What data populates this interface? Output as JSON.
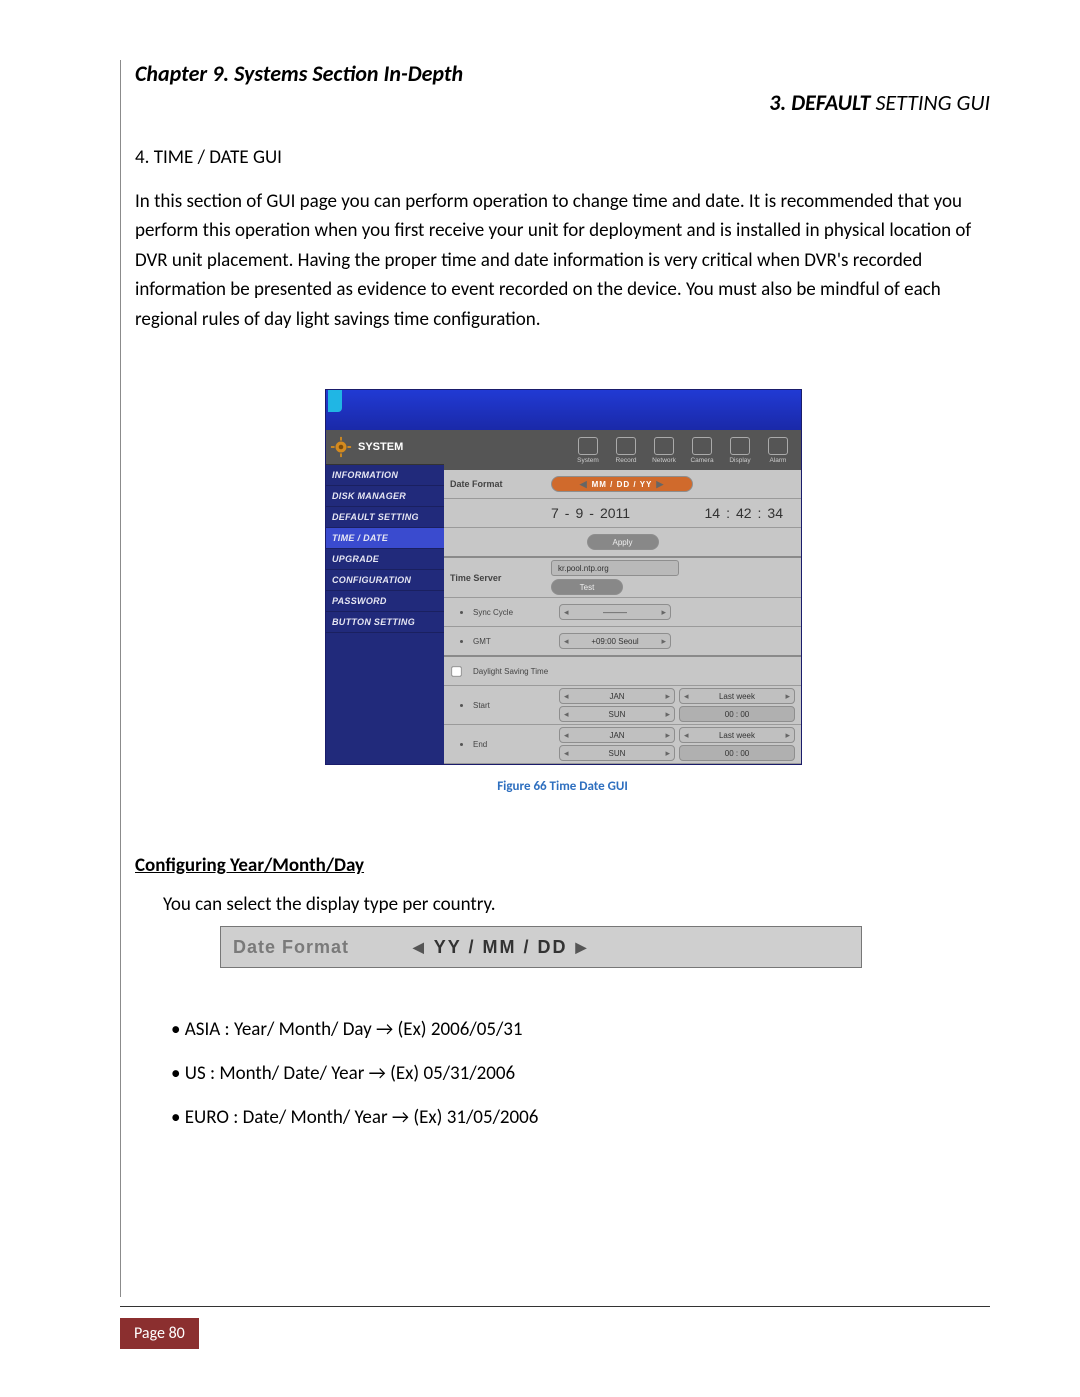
{
  "header": {
    "chapter": "Chapter 9. Systems Section In-Depth",
    "subsection_number": "3.",
    "subsection_bold": "DEFAULT",
    "subsection_rest": " SETTING GUI"
  },
  "section_label": "4. TIME / DATE GUI",
  "body_paragraph": "In this section of GUI page you can perform operation to change time and date.  It is recommended that you perform this operation when you first receive your unit for deployment and is installed in physical location of DVR unit placement. Having the proper time and date information is very critical when DVR's recorded information be presented as evidence to event recorded on the device. You must also be mindful of each regional rules of day light savings time configuration.",
  "dvr": {
    "system_label": "SYSTEM",
    "iconbar": [
      "System",
      "Record",
      "Network",
      "Camera",
      "Display",
      "Alarm"
    ],
    "side_items": [
      "INFORMATION",
      "DISK MANAGER",
      "DEFAULT SETTING",
      "TIME / DATE",
      "UPGRADE",
      "CONFIGURATION",
      "PASSWORD",
      "BUTTON SETTING"
    ],
    "active_side_index": 3,
    "date_format_label": "Date Format",
    "date_format_value": "MM  /  DD  /  YY",
    "date_month": "7",
    "date_day": "9",
    "date_year": "2011",
    "time_h": "14",
    "time_m": "42",
    "time_s": "34",
    "apply": "Apply",
    "time_server_label": "Time Server",
    "time_server_value": "kr.pool.ntp.org",
    "test": "Test",
    "sync_label": "Sync Cycle",
    "sync_value": "———",
    "gmt_label": "GMT",
    "gmt_value": "+09:00 Seoul",
    "dst_label": "Daylight Saving Time",
    "start_label": "Start",
    "end_label": "End",
    "month_val": "JAN",
    "day_val": "SUN",
    "week_val": "Last week",
    "time_val": "00  :  00"
  },
  "figure_caption": "Figure 66 Time Date GUI",
  "config_heading": "Configuring Year/Month/Day",
  "config_line": "You can select the display type per country.",
  "bar2": {
    "label": "Date Format",
    "value": "YY   /   MM   /   DD"
  },
  "bullets": [
    "• ASIA  : Year/ Month/ Day → (Ex) 2006/05/31",
    "• US    : Month/ Date/ Year → (Ex) 05/31/2006",
    "• EURO : Date/ Month/ Year → (Ex) 31/05/2006"
  ],
  "page_badge": "Page 80"
}
